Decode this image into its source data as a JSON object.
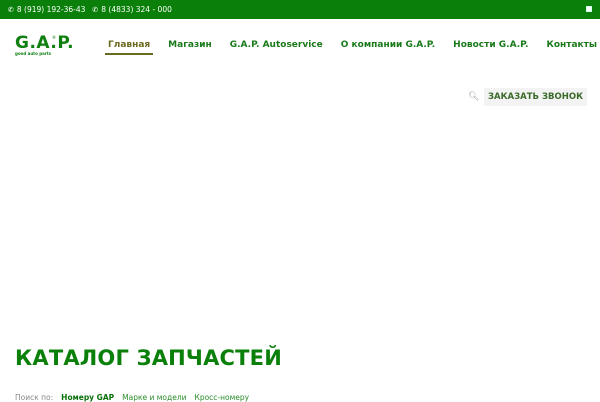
{
  "topbar": {
    "phones": [
      "8 (919) 192-36-43",
      "8 (4833) 324 - 000"
    ]
  },
  "logo": {
    "text": "GAP",
    "tagline": "good auto parts"
  },
  "nav": {
    "items": [
      "Главная",
      "Магазин",
      "G.A.P. Autoservice",
      "О компании G.A.P.",
      "Новости G.A.P.",
      "Контакты"
    ],
    "active": 0
  },
  "header": {
    "call_button": "ЗАКАЗАТЬ ЗВОНОК"
  },
  "main": {
    "title": "КАТАЛОГ ЗАПЧАСТЕЙ",
    "search_label": "Поиск по:",
    "tabs": [
      "Номеру GAP",
      "Марке и модели",
      "Кросс-номеру"
    ]
  },
  "colors": {
    "brand": "#0a800a"
  }
}
